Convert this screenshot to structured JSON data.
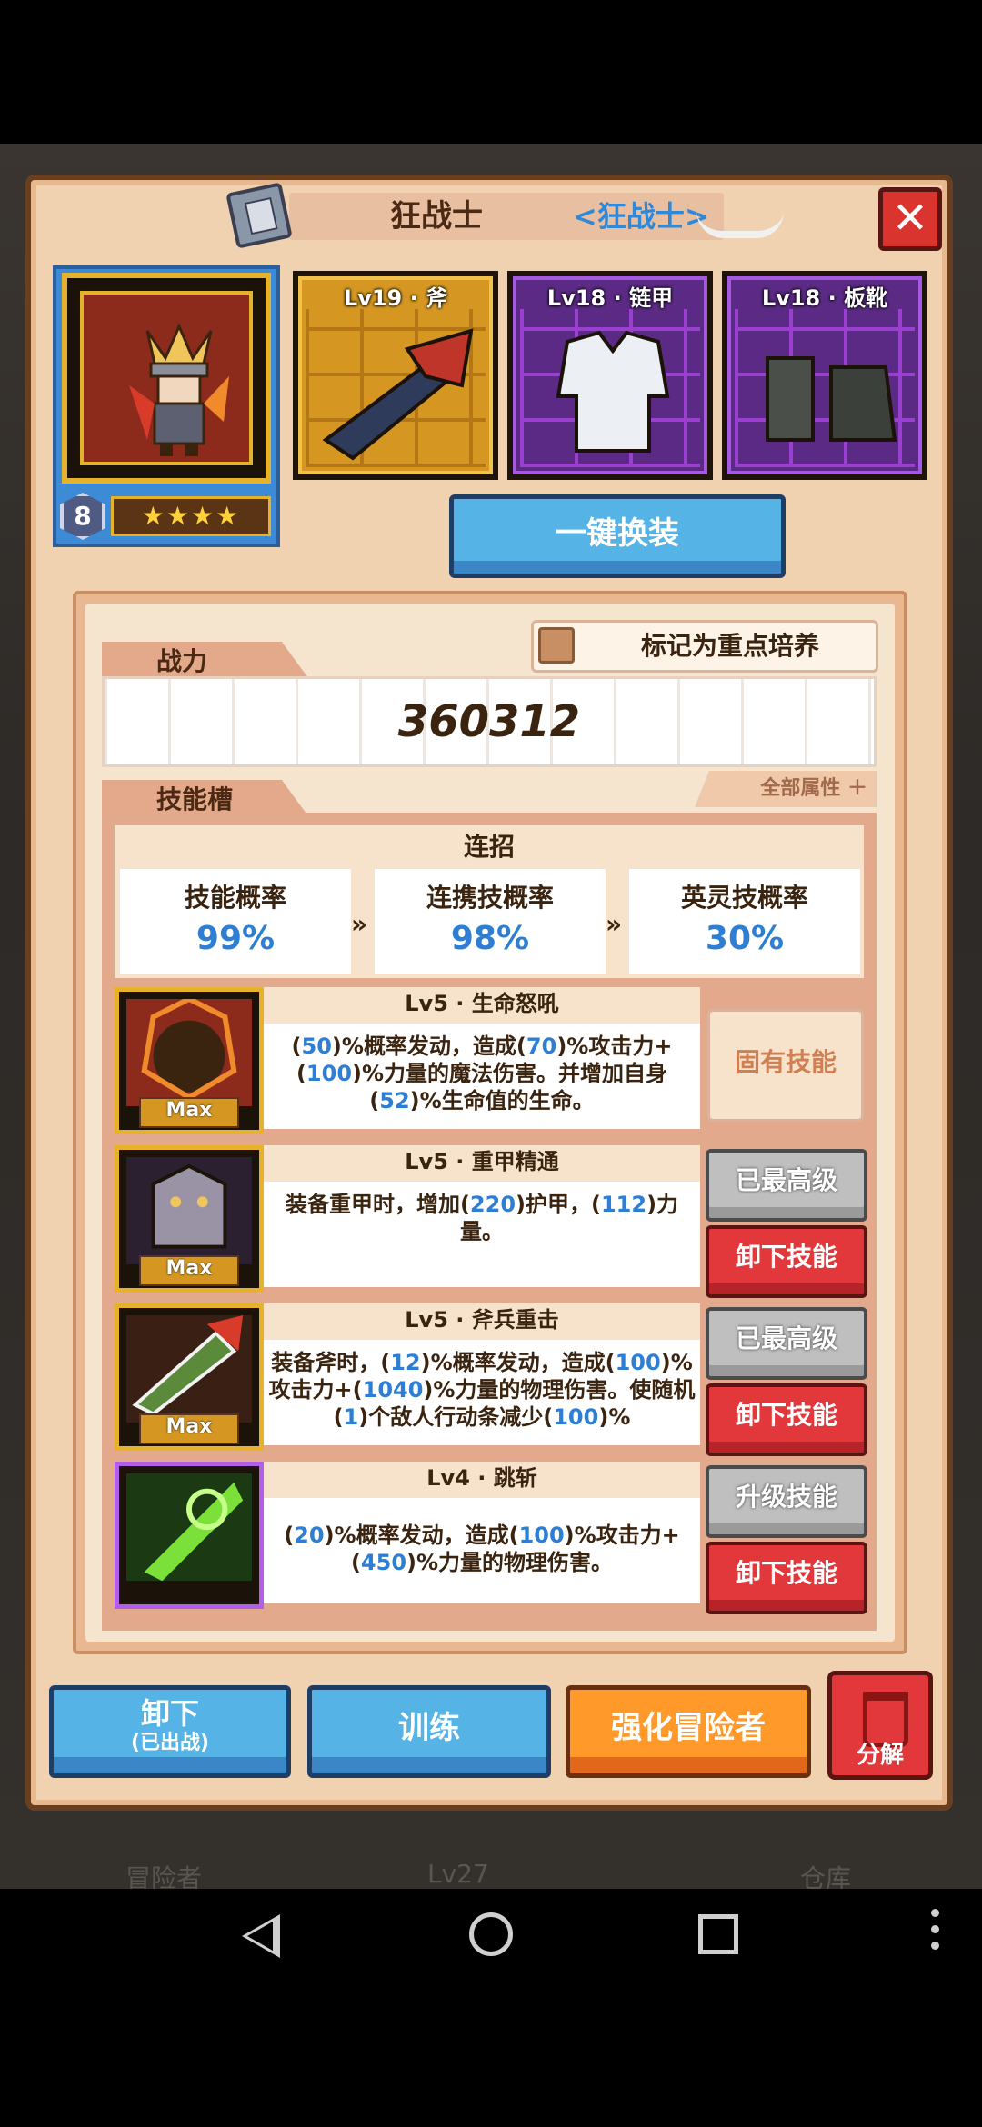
{
  "header": {
    "title": "狂战士",
    "class_label": "<狂战士>"
  },
  "hero": {
    "level_badge": "8",
    "stars": "★★★★"
  },
  "equipment": [
    {
      "label": "Lv19 · 斧",
      "rarity": "gold",
      "icon": "axe-icon"
    },
    {
      "label": "Lv18 · 链甲",
      "rarity": "purple",
      "icon": "chainmail-icon"
    },
    {
      "label": "Lv18 · 板靴",
      "rarity": "purple",
      "icon": "boots-icon"
    }
  ],
  "equip_all_button": "一键换装",
  "power": {
    "label": "战力",
    "value": "360312",
    "focus_toggle_label": "标记为重点培养"
  },
  "skills_section": {
    "label": "技能槽",
    "all_attributes": "全部属性 ＋",
    "combo": {
      "title": "连招",
      "cells": [
        {
          "name": "技能概率",
          "value": "99%"
        },
        {
          "name": "连携技概率",
          "value": "98%"
        },
        {
          "name": "英灵技概率",
          "value": "30%"
        }
      ]
    },
    "skills": [
      {
        "title": "Lv5 · 生命怒吼",
        "desc": [
          "(",
          "50",
          ")%概率发动，造成(",
          "70",
          ")%攻击力+(",
          "100",
          ")%力量的魔法伤害。并增加自身(",
          "52",
          ")%生命值的生命。"
        ],
        "badge": "Max",
        "icon": "roar-skill-icon",
        "rarity": "gold",
        "button_a": "固有技能"
      },
      {
        "title": "Lv5 · 重甲精通",
        "desc": [
          "装备重甲时，增加(",
          "220",
          ")护甲，(",
          "112",
          ")力量。"
        ],
        "badge": "Max",
        "icon": "heavy-armor-skill-icon",
        "rarity": "gold",
        "button_a": "已最高级",
        "button_b": "卸下技能"
      },
      {
        "title": "Lv5 · 斧兵重击",
        "desc": [
          "装备斧时，(",
          "12",
          ")%概率发动，造成(",
          "100",
          ")%攻击力+(",
          "1040",
          ")%力量的物理伤害。使随机(",
          "1",
          ")个敌人行动条减少(",
          "100",
          ")%"
        ],
        "badge": "Max",
        "icon": "axe-strike-skill-icon",
        "rarity": "gold",
        "button_a": "已最高级",
        "button_b": "卸下技能"
      },
      {
        "title": "Lv4 · 跳斩",
        "desc": [
          "(",
          "20",
          ")%概率发动，造成(",
          "100",
          ")%攻击力+(",
          "450",
          ")%力量的物理伤害。"
        ],
        "icon": "leap-slash-skill-icon",
        "rarity": "purple",
        "button_a": "升级技能",
        "button_b": "卸下技能"
      }
    ]
  },
  "bottom_bar": {
    "unequip_label": "卸下",
    "unequip_sub": "(已出战)",
    "train_label": "训练",
    "enhance_label": "强化冒险者",
    "decompose_label": "分解"
  },
  "background": {
    "left_text": "冒险者",
    "middle_text": "Lv27",
    "right_text": "仓库"
  },
  "colors": {
    "accent_blue": "#2e7fd4",
    "dialog_bg": "#f1d2b0",
    "gold_frame": "#e7b22b",
    "purple_frame": "#b35ee8",
    "danger_red": "#e2383c"
  }
}
